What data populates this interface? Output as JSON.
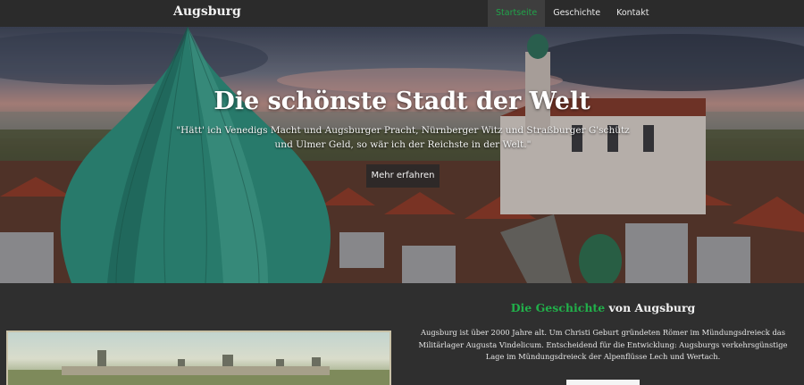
{
  "navbar": {
    "brand": "Augsburg",
    "items": [
      {
        "label": "Startseite",
        "active": true
      },
      {
        "label": "Geschichte",
        "active": false
      },
      {
        "label": "Kontakt",
        "active": false
      }
    ]
  },
  "hero": {
    "title": "Die schönste Stadt der Welt",
    "quote": "\"Hätt' ich Venedigs Macht und Augsburger Pracht, Nürnberger Witz und Straßburger G'schütz und Ulmer Geld, so wär ich der Reichste in der Welt.\"",
    "button": "Mehr erfahren"
  },
  "history": {
    "title_accent": "Die Geschichte",
    "title_rest": " von Augsburg",
    "text": "Augsburg ist über 2000 Jahre alt. Um Christi Geburt gründeten Römer im Mündungsdreieck das Militärlager Augusta Vindelicum. Entscheidend für die Entwicklung: Augsburgs verkehrsgünstige Lage im Mündungsdreieck der Alpenflüsse Lech und Wertach."
  },
  "colors": {
    "accent": "#21a34a",
    "navbar": "#2b2b2b",
    "background": "#2f2f2f"
  }
}
